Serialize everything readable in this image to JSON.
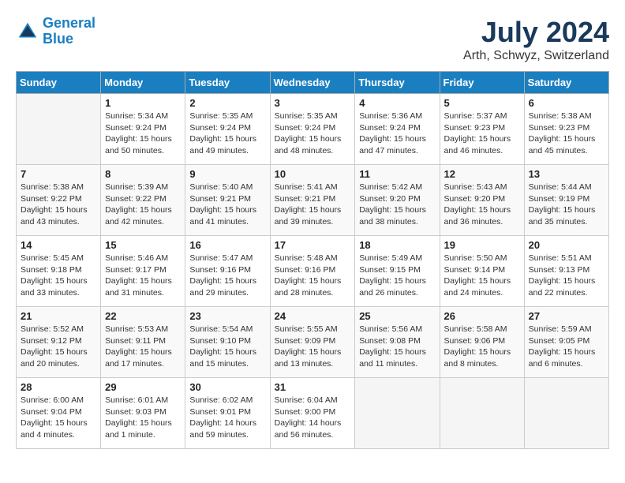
{
  "header": {
    "logo_line1": "General",
    "logo_line2": "Blue",
    "month_year": "July 2024",
    "location": "Arth, Schwyz, Switzerland"
  },
  "weekdays": [
    "Sunday",
    "Monday",
    "Tuesday",
    "Wednesday",
    "Thursday",
    "Friday",
    "Saturday"
  ],
  "weeks": [
    [
      {
        "day": "",
        "info": ""
      },
      {
        "day": "1",
        "info": "Sunrise: 5:34 AM\nSunset: 9:24 PM\nDaylight: 15 hours\nand 50 minutes."
      },
      {
        "day": "2",
        "info": "Sunrise: 5:35 AM\nSunset: 9:24 PM\nDaylight: 15 hours\nand 49 minutes."
      },
      {
        "day": "3",
        "info": "Sunrise: 5:35 AM\nSunset: 9:24 PM\nDaylight: 15 hours\nand 48 minutes."
      },
      {
        "day": "4",
        "info": "Sunrise: 5:36 AM\nSunset: 9:24 PM\nDaylight: 15 hours\nand 47 minutes."
      },
      {
        "day": "5",
        "info": "Sunrise: 5:37 AM\nSunset: 9:23 PM\nDaylight: 15 hours\nand 46 minutes."
      },
      {
        "day": "6",
        "info": "Sunrise: 5:38 AM\nSunset: 9:23 PM\nDaylight: 15 hours\nand 45 minutes."
      }
    ],
    [
      {
        "day": "7",
        "info": "Sunrise: 5:38 AM\nSunset: 9:22 PM\nDaylight: 15 hours\nand 43 minutes."
      },
      {
        "day": "8",
        "info": "Sunrise: 5:39 AM\nSunset: 9:22 PM\nDaylight: 15 hours\nand 42 minutes."
      },
      {
        "day": "9",
        "info": "Sunrise: 5:40 AM\nSunset: 9:21 PM\nDaylight: 15 hours\nand 41 minutes."
      },
      {
        "day": "10",
        "info": "Sunrise: 5:41 AM\nSunset: 9:21 PM\nDaylight: 15 hours\nand 39 minutes."
      },
      {
        "day": "11",
        "info": "Sunrise: 5:42 AM\nSunset: 9:20 PM\nDaylight: 15 hours\nand 38 minutes."
      },
      {
        "day": "12",
        "info": "Sunrise: 5:43 AM\nSunset: 9:20 PM\nDaylight: 15 hours\nand 36 minutes."
      },
      {
        "day": "13",
        "info": "Sunrise: 5:44 AM\nSunset: 9:19 PM\nDaylight: 15 hours\nand 35 minutes."
      }
    ],
    [
      {
        "day": "14",
        "info": "Sunrise: 5:45 AM\nSunset: 9:18 PM\nDaylight: 15 hours\nand 33 minutes."
      },
      {
        "day": "15",
        "info": "Sunrise: 5:46 AM\nSunset: 9:17 PM\nDaylight: 15 hours\nand 31 minutes."
      },
      {
        "day": "16",
        "info": "Sunrise: 5:47 AM\nSunset: 9:16 PM\nDaylight: 15 hours\nand 29 minutes."
      },
      {
        "day": "17",
        "info": "Sunrise: 5:48 AM\nSunset: 9:16 PM\nDaylight: 15 hours\nand 28 minutes."
      },
      {
        "day": "18",
        "info": "Sunrise: 5:49 AM\nSunset: 9:15 PM\nDaylight: 15 hours\nand 26 minutes."
      },
      {
        "day": "19",
        "info": "Sunrise: 5:50 AM\nSunset: 9:14 PM\nDaylight: 15 hours\nand 24 minutes."
      },
      {
        "day": "20",
        "info": "Sunrise: 5:51 AM\nSunset: 9:13 PM\nDaylight: 15 hours\nand 22 minutes."
      }
    ],
    [
      {
        "day": "21",
        "info": "Sunrise: 5:52 AM\nSunset: 9:12 PM\nDaylight: 15 hours\nand 20 minutes."
      },
      {
        "day": "22",
        "info": "Sunrise: 5:53 AM\nSunset: 9:11 PM\nDaylight: 15 hours\nand 17 minutes."
      },
      {
        "day": "23",
        "info": "Sunrise: 5:54 AM\nSunset: 9:10 PM\nDaylight: 15 hours\nand 15 minutes."
      },
      {
        "day": "24",
        "info": "Sunrise: 5:55 AM\nSunset: 9:09 PM\nDaylight: 15 hours\nand 13 minutes."
      },
      {
        "day": "25",
        "info": "Sunrise: 5:56 AM\nSunset: 9:08 PM\nDaylight: 15 hours\nand 11 minutes."
      },
      {
        "day": "26",
        "info": "Sunrise: 5:58 AM\nSunset: 9:06 PM\nDaylight: 15 hours\nand 8 minutes."
      },
      {
        "day": "27",
        "info": "Sunrise: 5:59 AM\nSunset: 9:05 PM\nDaylight: 15 hours\nand 6 minutes."
      }
    ],
    [
      {
        "day": "28",
        "info": "Sunrise: 6:00 AM\nSunset: 9:04 PM\nDaylight: 15 hours\nand 4 minutes."
      },
      {
        "day": "29",
        "info": "Sunrise: 6:01 AM\nSunset: 9:03 PM\nDaylight: 15 hours\nand 1 minute."
      },
      {
        "day": "30",
        "info": "Sunrise: 6:02 AM\nSunset: 9:01 PM\nDaylight: 14 hours\nand 59 minutes."
      },
      {
        "day": "31",
        "info": "Sunrise: 6:04 AM\nSunset: 9:00 PM\nDaylight: 14 hours\nand 56 minutes."
      },
      {
        "day": "",
        "info": ""
      },
      {
        "day": "",
        "info": ""
      },
      {
        "day": "",
        "info": ""
      }
    ]
  ]
}
